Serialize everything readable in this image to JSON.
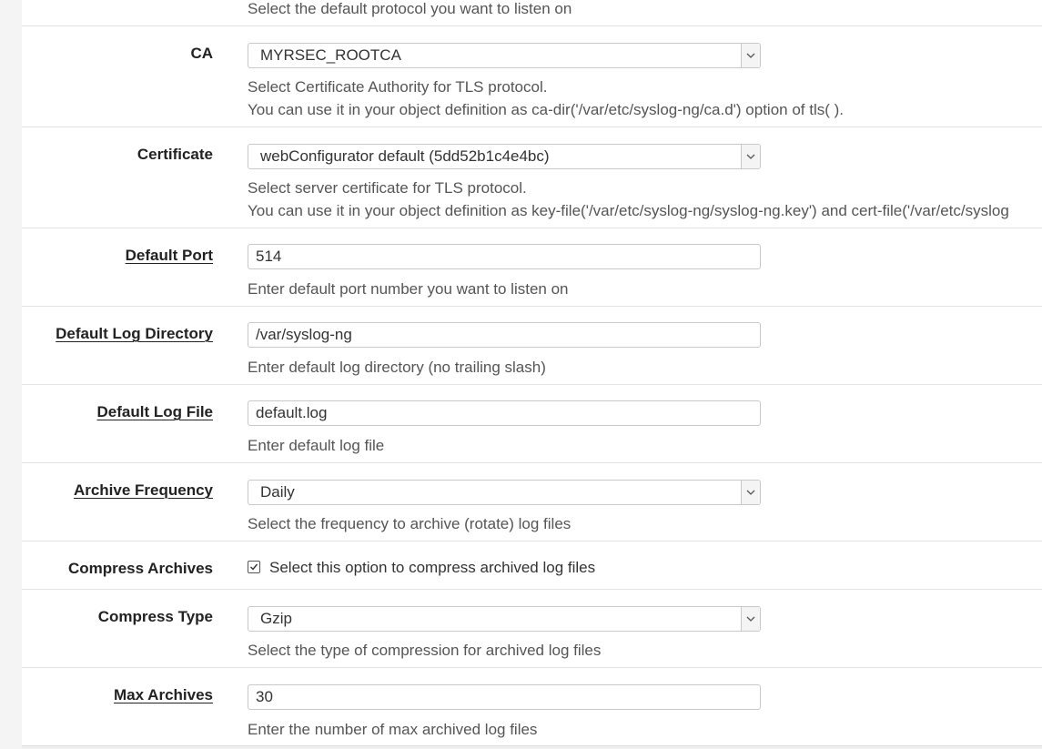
{
  "protocol": {
    "help": "Select the default protocol you want to listen on"
  },
  "ca": {
    "label": "CA",
    "value": "MYRSEC_ROOTCA",
    "help_line1": "Select Certificate Authority for TLS protocol.",
    "help_line2": "You can use it in your object definition as ca-dir('/var/etc/syslog-ng/ca.d') option of tls( )."
  },
  "certificate": {
    "label": "Certificate",
    "value": "webConfigurator default (5dd52b1c4e4bc)",
    "help_line1": "Select server certificate for TLS protocol.",
    "help_line2": "You can use it in your object definition as key-file('/var/etc/syslog-ng/syslog-ng.key') and cert-file('/var/etc/syslog"
  },
  "default_port": {
    "label": "Default Port",
    "value": "514",
    "help": "Enter default port number you want to listen on"
  },
  "default_log_directory": {
    "label": "Default Log Directory",
    "value": "/var/syslog-ng",
    "help": "Enter default log directory (no trailing slash)"
  },
  "default_log_file": {
    "label": "Default Log File",
    "value": "default.log",
    "help": "Enter default log file"
  },
  "archive_frequency": {
    "label": "Archive Frequency",
    "value": "Daily",
    "help": "Select the frequency to archive (rotate) log files"
  },
  "compress_archives": {
    "label": "Compress Archives",
    "checked": true,
    "option_text": "Select this option to compress archived log files"
  },
  "compress_type": {
    "label": "Compress Type",
    "value": "Gzip",
    "help": "Select the type of compression for archived log files"
  },
  "max_archives": {
    "label": "Max Archives",
    "value": "30",
    "help": "Enter the number of max archived log files"
  }
}
